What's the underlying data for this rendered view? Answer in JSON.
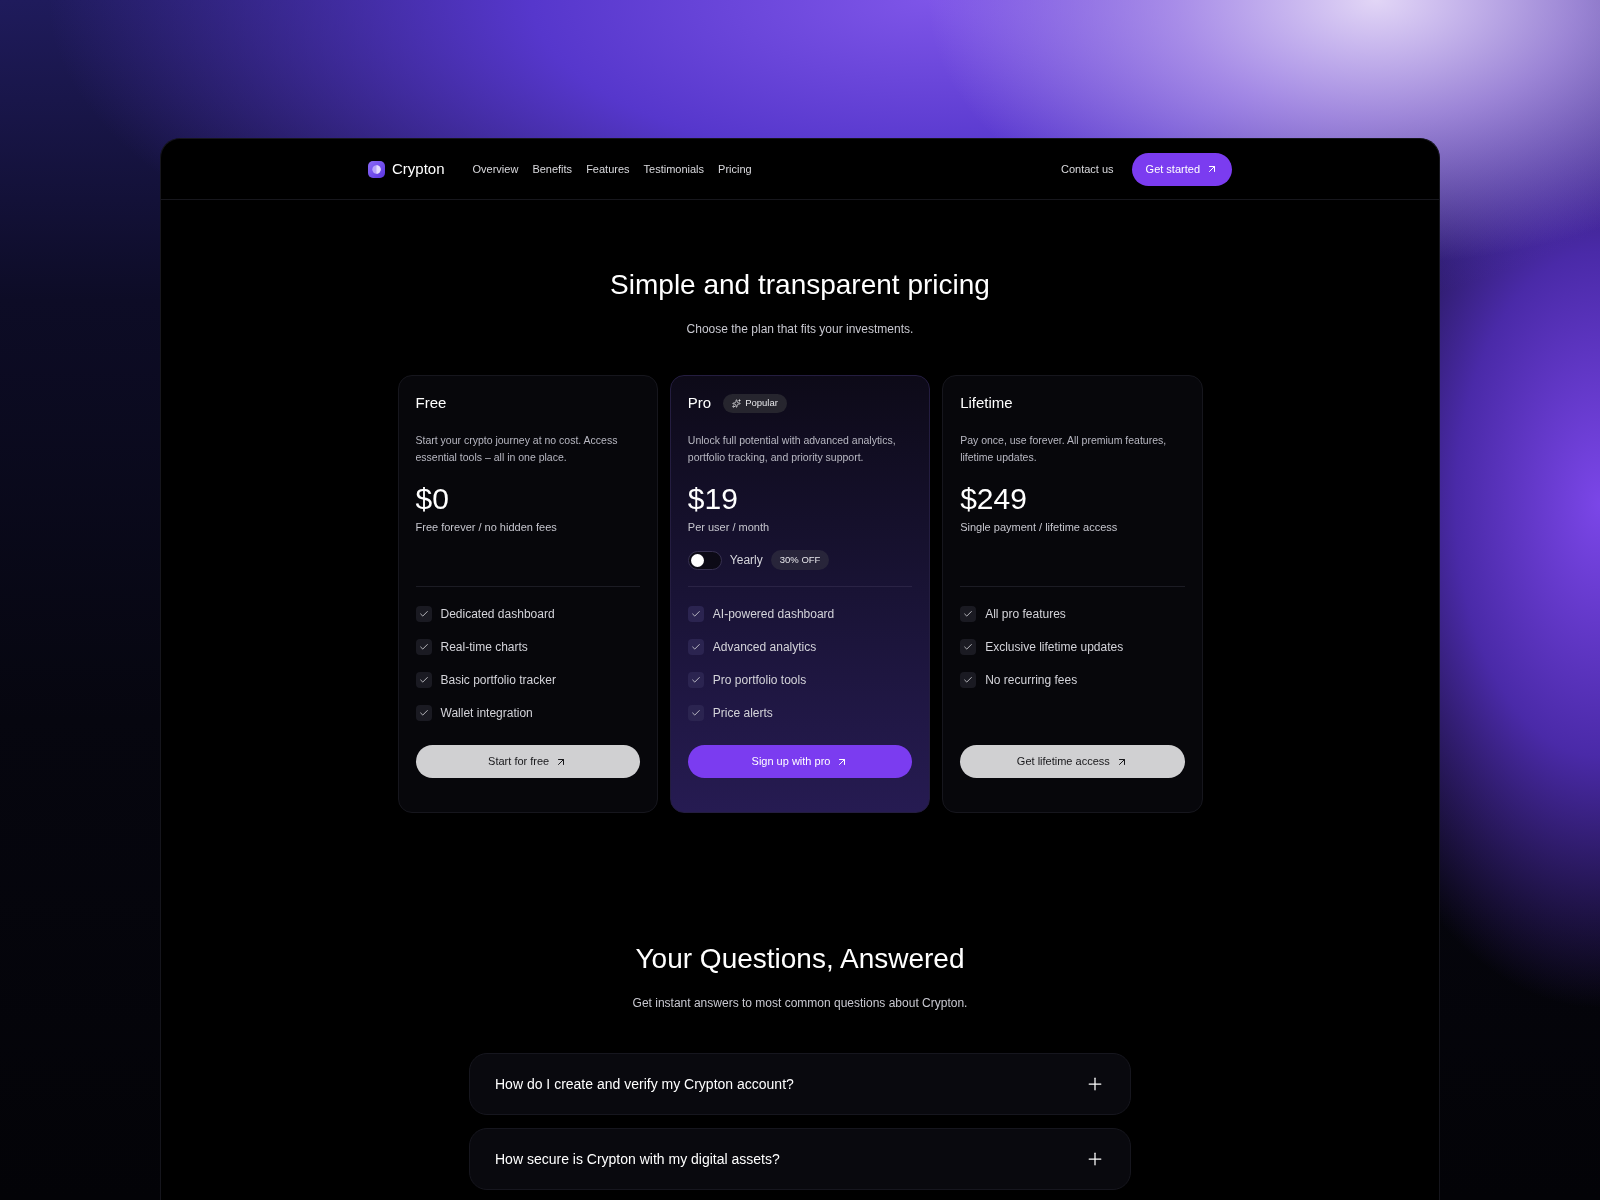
{
  "nav": {
    "brand": "Crypton",
    "links": [
      "Overview",
      "Benefits",
      "Features",
      "Testimonials",
      "Pricing"
    ],
    "contact": "Contact us",
    "cta": "Get started"
  },
  "pricing": {
    "title": "Simple and transparent pricing",
    "subtitle": "Choose the plan that fits your investments.",
    "plans": [
      {
        "name": "Free",
        "highlighted": false,
        "description": "Start your crypto journey at no cost. Access essential tools – all in one place.",
        "price": "$0",
        "price_note": "Free forever / no hidden fees",
        "features": [
          "Dedicated dashboard",
          "Real-time charts",
          "Basic portfolio tracker",
          "Wallet integration"
        ],
        "button": "Start for free"
      },
      {
        "name": "Pro",
        "highlighted": true,
        "badge": "Popular",
        "description": "Unlock full potential with advanced analytics, portfolio tracking, and priority support.",
        "price": "$19",
        "price_note": "Per user / month",
        "toggle": {
          "label": "Yearly",
          "on": false,
          "tag": "30% OFF"
        },
        "features": [
          "AI-powered dashboard",
          "Advanced analytics",
          "Pro portfolio tools",
          "Price alerts"
        ],
        "button": "Sign up with pro"
      },
      {
        "name": "Lifetime",
        "highlighted": false,
        "description": "Pay once, use forever. All premium features, lifetime updates.",
        "price": "$249",
        "price_note": "Single payment / lifetime access",
        "features": [
          "All pro features",
          "Exclusive lifetime updates",
          "No recurring fees"
        ],
        "button": "Get lifetime access"
      }
    ]
  },
  "faq": {
    "title": "Your Questions, Answered",
    "subtitle": "Get instant answers to most common questions about Crypton.",
    "items": [
      {
        "question": "How do I create and verify my Crypton account?",
        "expanded": false
      },
      {
        "question": "How secure is Crypton with my digital assets?",
        "expanded": false
      }
    ]
  }
}
